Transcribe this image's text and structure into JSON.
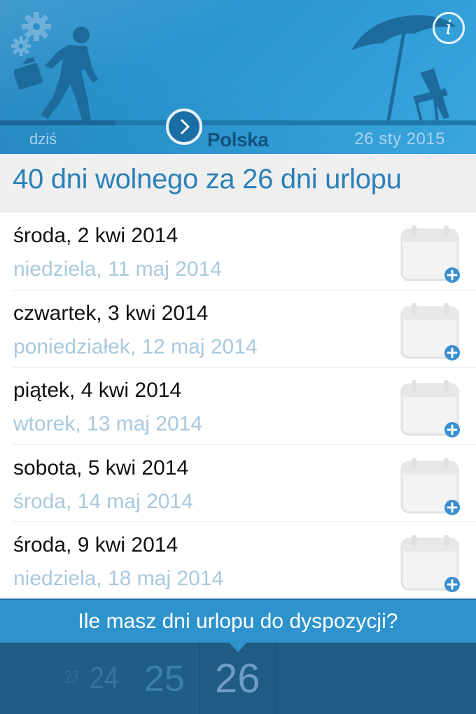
{
  "header": {
    "today_label": "dziś",
    "country": "Polska",
    "date": "26 sty 2015",
    "info_label": "i"
  },
  "summary": {
    "text": "40 dni wolnego za 26 dni urlopu"
  },
  "items": [
    {
      "start": "środa, 2 kwi 2014",
      "end": "niedziela, 11 maj 2014"
    },
    {
      "start": "czwartek, 3 kwi 2014",
      "end": "poniedziałek, 12 maj 2014"
    },
    {
      "start": "piątek, 4 kwi 2014",
      "end": "wtorek, 13 maj 2014"
    },
    {
      "start": "sobota, 5 kwi 2014",
      "end": "środa, 14 maj 2014"
    },
    {
      "start": "środa, 9 kwi 2014",
      "end": "niedziela, 18 maj 2014"
    }
  ],
  "bottom": {
    "question": "Ile masz dni urlopu do dyspozycji?",
    "picker": [
      "23",
      "24",
      "25",
      "26"
    ],
    "selected": "26"
  },
  "colors": {
    "header_blue": "#2a95d0",
    "accent_blue": "#2b80b8",
    "muted_blue": "#a9c9de",
    "picker_bg": "#205d86"
  }
}
